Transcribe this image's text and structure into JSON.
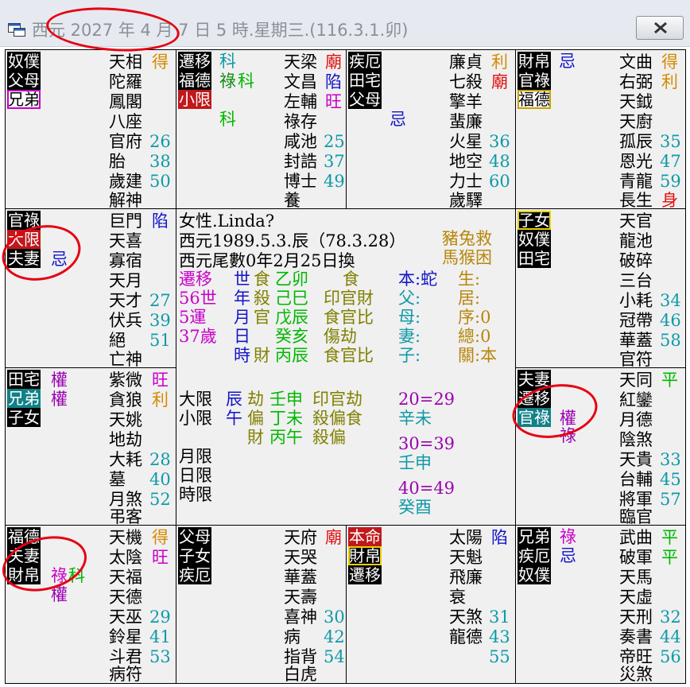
{
  "window": {
    "title": "西元 2027 年 4 月 7 日 5 時.星期三.(116.3.1.卯)",
    "close_label": "✕",
    "icons": {
      "app": "app-window-icon",
      "close": "close-icon"
    },
    "annotation_color": "#e60012"
  },
  "tl": {
    "palaces": [
      "奴僕",
      "父母",
      "兄弟"
    ],
    "stars": [
      "天相",
      "陀羅",
      "鳳閣",
      "八座",
      "官府",
      "胎",
      "歲建",
      "解神"
    ],
    "marks": [
      "得"
    ],
    "nums": [
      "26",
      "38",
      "50"
    ]
  },
  "tm": {
    "palaces": [
      "遷移",
      "福德",
      "小限"
    ],
    "hua": [
      "科",
      "祿",
      "科",
      "科"
    ],
    "stars": [
      "天梁",
      "文昌",
      "左輔",
      "祿存",
      "咸池",
      "封誥",
      "博士",
      "養"
    ],
    "marks": [
      "廟",
      "陷",
      "旺"
    ],
    "nums": [
      "25",
      "37",
      "49"
    ]
  },
  "tr": {
    "palaces": [
      "疾厄",
      "田宅",
      "父母"
    ],
    "hua": [
      "忌"
    ],
    "stars": [
      "廉貞",
      "七殺",
      "擎羊",
      "蜚廉",
      "火星",
      "地空",
      "力士",
      "歲驛"
    ],
    "marks": [
      "利",
      "廟"
    ],
    "nums": [
      "36",
      "48",
      "60"
    ]
  },
  "tf": {
    "palaces": [
      "財帛",
      "官祿",
      "福德"
    ],
    "hua": [
      "忌"
    ],
    "stars": [
      "文曲",
      "右弼",
      "天鉞",
      "天廚",
      "孤辰",
      "恩光",
      "青龍",
      "長生"
    ],
    "marks": [
      "得",
      "利",
      "身"
    ],
    "nums": [
      "35",
      "47",
      "59"
    ]
  },
  "ml": {
    "palaces": [
      "官祿",
      "大限",
      "夫妻"
    ],
    "hua": [
      "忌"
    ],
    "stars": [
      "巨門",
      "天喜",
      "寡宿",
      "天月",
      "天才",
      "伏兵",
      "絕",
      "亡神"
    ],
    "marks": [
      "陷"
    ],
    "nums": [
      "27",
      "39",
      "51"
    ]
  },
  "mr": {
    "palaces": [
      "子女",
      "奴僕",
      "田宅"
    ],
    "stars": [
      "天官",
      "龍池",
      "破碎",
      "三台",
      "小耗",
      "冠帶",
      "華蓋",
      "官符"
    ],
    "nums": [
      "34",
      "46",
      "58"
    ]
  },
  "ll": {
    "palaces": [
      "田宅",
      "兄弟",
      "子女"
    ],
    "hua": [
      "權",
      "權"
    ],
    "stars": [
      "紫微",
      "貪狼",
      "天姚",
      "地劫",
      "大耗",
      "墓",
      "月煞",
      "弔客"
    ],
    "marks": [
      "旺",
      "利"
    ],
    "nums": [
      "28",
      "40",
      "52"
    ]
  },
  "lr": {
    "palaces": [
      "夫妻",
      "遷移",
      "官祿"
    ],
    "hua": [
      "權",
      "祿"
    ],
    "stars": [
      "天同",
      "紅鑾",
      "月德",
      "陰煞",
      "天貴",
      "台輔",
      "將軍",
      "臨官"
    ],
    "marks": [
      "平"
    ],
    "nums": [
      "33",
      "45",
      "57"
    ]
  },
  "bl": {
    "palaces": [
      "福德",
      "夫妻",
      "財帛"
    ],
    "hua": [
      "祿",
      "科",
      "權"
    ],
    "stars": [
      "天機",
      "太陰",
      "天福",
      "天德",
      "天巫",
      "鈴星",
      "斗君",
      "病符"
    ],
    "marks": [
      "得",
      "旺"
    ],
    "nums": [
      "29",
      "41",
      "53"
    ]
  },
  "bm": {
    "palaces": [
      "父母",
      "子女",
      "疾厄"
    ],
    "stars": [
      "天府",
      "天哭",
      "華蓋",
      "天壽",
      "喜神",
      "病",
      "指背",
      "白虎"
    ],
    "marks": [
      "廟"
    ],
    "nums": [
      "30",
      "42",
      "54"
    ]
  },
  "br": {
    "palaces": [
      "本命",
      "財帛",
      "遷移"
    ],
    "stars": [
      "太陽",
      "天魁",
      "飛廉",
      "衰",
      "天煞",
      "龍德"
    ],
    "marks": [
      "陷"
    ],
    "nums": [
      "31",
      "43",
      "55"
    ]
  },
  "bf": {
    "palaces": [
      "兄弟",
      "疾厄",
      "奴僕"
    ],
    "hua": [
      "祿",
      "忌"
    ],
    "stars": [
      "武曲",
      "破軍",
      "天馬",
      "天虛",
      "天刑",
      "奏書",
      "帝旺",
      "災煞"
    ],
    "marks": [
      "平",
      "平"
    ],
    "nums": [
      "32",
      "44",
      "56"
    ]
  },
  "center": {
    "gender_name": "女性.Linda?",
    "birth": "西元1989.5.3.辰（78.3.28）",
    "tail": "西元尾數0年2月25日換",
    "zodiac1": "豬兔救",
    "zodiac2": "馬猴困",
    "col1": [
      "遷移",
      "56世",
      "5運",
      "37歲"
    ],
    "col2": [
      "世",
      "年",
      "月",
      "日",
      "時"
    ],
    "col3": [
      "食",
      "殺",
      "官",
      "",
      "財"
    ],
    "col4": [
      "乙卯",
      "己巳",
      "戊辰",
      "癸亥",
      "丙辰"
    ],
    "col5": [
      "食",
      "印官財",
      "食官比",
      "傷劫",
      "食官比"
    ],
    "col6": [
      "本:蛇",
      "父:",
      "母:",
      "妻:",
      "子:"
    ],
    "col7": [
      "生:",
      "居:",
      "序:0",
      "總:0",
      "關:本"
    ],
    "limits": [
      "大限",
      "小限",
      "",
      "月限",
      "日限",
      "時限"
    ],
    "lim_b": [
      "辰",
      "午"
    ],
    "lim_c": [
      "劫",
      "偏",
      "財"
    ],
    "lim_d": [
      "壬申",
      "丁未",
      "丙午"
    ],
    "lim_e": [
      "印官劫",
      "殺偏食",
      "殺偏"
    ],
    "ranges": [
      "20=29",
      "辛未",
      "30=39",
      "壬申",
      "40=49",
      "癸酉"
    ]
  }
}
